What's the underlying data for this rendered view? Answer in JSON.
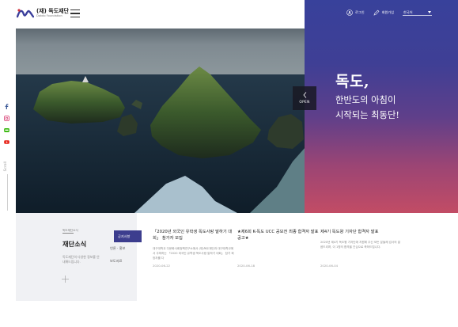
{
  "header": {
    "logo_main": "(재) 독도재단",
    "logo_sub": "Dokdo Foundation",
    "menu_icon": "hamburger-icon"
  },
  "utility": {
    "login": "로그인",
    "join": "회원가입",
    "language": "한국어"
  },
  "hero": {
    "title_line1": "독도,",
    "title_line2": "한반도의 아침이",
    "title_line3": "시작되는 최동단!",
    "open_label": "OPEN"
  },
  "colors": {
    "gradient_top": "#38419b",
    "gradient_bottom": "#c24c65",
    "tab_active": "#3c3d8e"
  },
  "sns": {
    "icons": [
      "facebook-icon",
      "instagram-icon",
      "blog-icon",
      "youtube-icon"
    ],
    "scroll_label": "Scroll"
  },
  "news": {
    "small_label": "독도재단소식",
    "title": "재단소식",
    "desc": "독도재단의 다양한 정보를 안내해드립니다.",
    "tabs": [
      "공지사항",
      "언론 · 홍보",
      "보도자료"
    ],
    "cards": [
      {
        "title": "「2020년 외국인 유학생 독도사랑 말하기 대회」 참가자 모집",
        "body": "대구대학교 다문화사회정책연구소에서 (재)독도재단과 대구대학교에서 주최하는 「2020 외국인 유학생 독도사랑 말하기 대회」 참가 희망자를 다",
        "date": "2020-06-22"
      },
      {
        "title": "★제6회 K-독도 UCC 공모전 최종 합격자 발표 공고★",
        "body": "",
        "date": "2020-06-18"
      },
      {
        "title": "제4기 독도왕 기자단 합격자 발표",
        "body": "2020년 제4기 독도왕 기자단에 지원해 주신 모든 분들께 감사의 말씀드리며, 이 1명의 합격을 진심으로 축하드립니다.",
        "date": "2020-06-04"
      }
    ]
  }
}
